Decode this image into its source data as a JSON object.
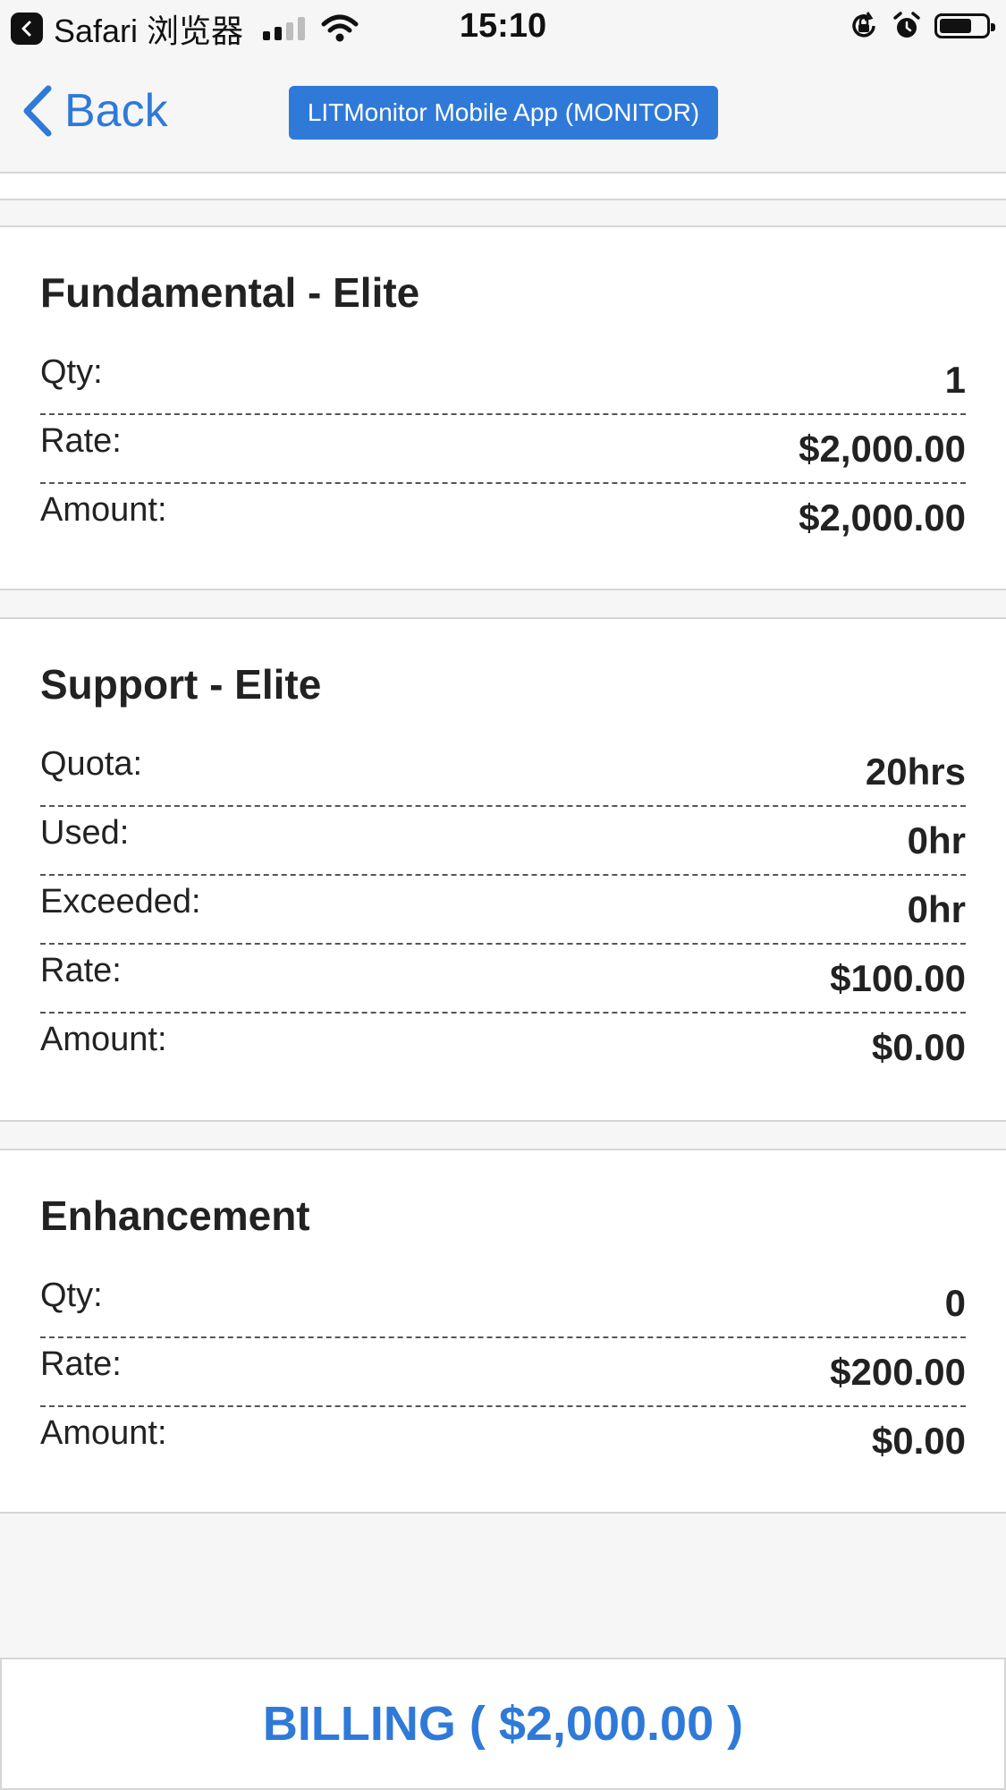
{
  "status_bar": {
    "app": "Safari 浏览器",
    "time": "15:10",
    "battery_level": 0.7
  },
  "nav": {
    "back_label": "Back",
    "title": "LITMonitor Mobile App (MONITOR)"
  },
  "sections": [
    {
      "title": "Fundamental - Elite",
      "rows": [
        {
          "label": "Qty:",
          "value": "1"
        },
        {
          "label": "Rate:",
          "value": "$2,000.00"
        },
        {
          "label": "Amount:",
          "value": "$2,000.00"
        }
      ]
    },
    {
      "title": "Support - Elite",
      "rows": [
        {
          "label": "Quota:",
          "value": "20hrs"
        },
        {
          "label": "Used:",
          "value": "0hr"
        },
        {
          "label": "Exceeded:",
          "value": "0hr"
        },
        {
          "label": "Rate:",
          "value": "$100.00"
        },
        {
          "label": "Amount:",
          "value": "$0.00"
        }
      ]
    },
    {
      "title": "Enhancement",
      "rows": [
        {
          "label": "Qty:",
          "value": "0"
        },
        {
          "label": "Rate:",
          "value": "$200.00"
        },
        {
          "label": "Amount:",
          "value": "$0.00"
        }
      ]
    }
  ],
  "billing_label": "BILLING ( $2,000.00 )",
  "colors": {
    "accent": "#2f7ad8",
    "background": "#f6f6f6",
    "card": "#ffffff",
    "text": "#222222"
  }
}
